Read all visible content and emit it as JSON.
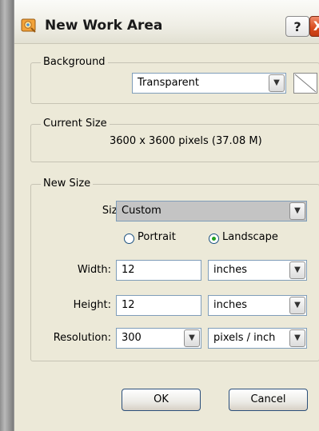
{
  "window": {
    "title": "New Work Area",
    "help_label": "?",
    "close_label": "X"
  },
  "background": {
    "legend": "Background",
    "value": "Transparent"
  },
  "current_size": {
    "legend": "Current Size",
    "text": "3600 x 3600 pixels (37.08 M)"
  },
  "new_size": {
    "legend": "New Size",
    "size_label": "Size:",
    "size_value": "Custom",
    "orientation": {
      "portrait_label": "Portrait",
      "landscape_label": "Landscape",
      "selected": "Landscape"
    },
    "width_label": "Width:",
    "width_value": "12",
    "width_unit": "inches",
    "height_label": "Height:",
    "height_value": "12",
    "height_unit": "inches",
    "resolution_label": "Resolution:",
    "resolution_value": "300",
    "resolution_unit": "pixels / inch"
  },
  "buttons": {
    "ok": "OK",
    "cancel": "Cancel"
  },
  "icons": {
    "app": "app-icon",
    "dropdown": "chevron-down-icon",
    "swatch": "transparent-swatch-icon"
  },
  "colors": {
    "dialog_bg": "#ece9d8",
    "close": "#d84a1d",
    "radio_selected": "#21a121"
  }
}
